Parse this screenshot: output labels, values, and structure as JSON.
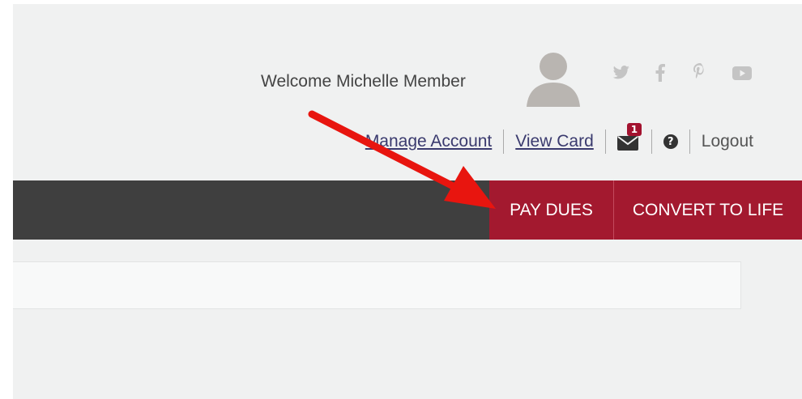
{
  "header": {
    "welcome_text": "Welcome Michelle Member",
    "social_icons": [
      "twitter-icon",
      "facebook-icon",
      "pinterest-icon",
      "youtube-icon"
    ]
  },
  "account_links": {
    "manage_account": "Manage Account",
    "view_card": "View Card",
    "messages_count": "1",
    "help_glyph": "?",
    "logout": "Logout"
  },
  "nav": {
    "pay_dues": "PAY DUES",
    "convert_to_life": "CONVERT TO LIFE"
  },
  "colors": {
    "accent": "#a3192f",
    "navbar": "#3f3f3f",
    "annotation_arrow": "#e8150f"
  }
}
